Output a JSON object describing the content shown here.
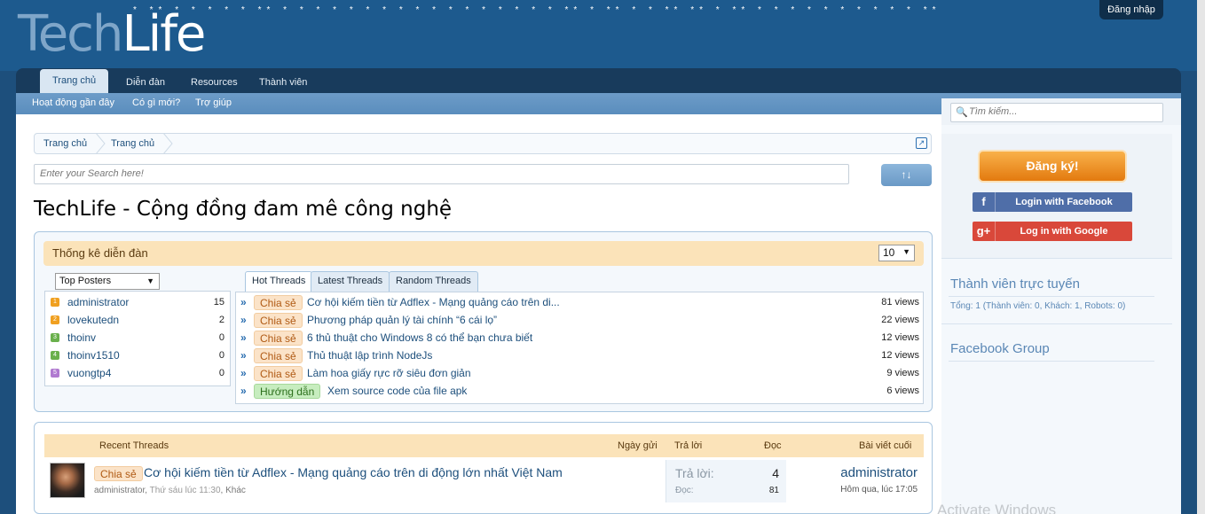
{
  "header": {
    "logo_part1": "Tech",
    "logo_part2": "Life",
    "stars": "* ** * *   *    * *   **  * * *      *   *  *  * *   *  * *  * *   *   *     *  *  **  *   ** * * ** **  * ** * *  * *  * *  *  * * *  **",
    "login_label": "Đăng nhập"
  },
  "nav": {
    "tabs": [
      "Trang chủ",
      "Diễn đàn",
      "Resources",
      "Thành viên"
    ],
    "subnav": [
      "Hoạt động gần đây",
      "Có gì mới?",
      "Trợ giúp"
    ]
  },
  "breadcrumb": [
    "Trang chủ",
    "Trang chủ"
  ],
  "search": {
    "placeholder": "Enter your Search here!"
  },
  "page_title": "TechLife - Cộng đồng đam mê công nghệ",
  "stats": {
    "title": "Thống kê diễn đàn",
    "limit": "10",
    "posters_select": "Top Posters",
    "posters": [
      {
        "name": "administrator",
        "count": "15",
        "badge": "1",
        "color": "#f0a020"
      },
      {
        "name": "lovekutedn",
        "count": "2",
        "badge": "2",
        "color": "#f0a020"
      },
      {
        "name": "thoinv",
        "count": "0",
        "badge": "3",
        "color": "#6ab04c"
      },
      {
        "name": "thoinv1510",
        "count": "0",
        "badge": "4",
        "color": "#6ab04c"
      },
      {
        "name": "vuongtp4",
        "count": "0",
        "badge": "5",
        "color": "#b07ad0"
      }
    ],
    "tabs": [
      "Hot Threads",
      "Latest Threads",
      "Random Threads"
    ],
    "threads": [
      {
        "prefix": "Chia sẻ",
        "type": "share",
        "title": "Cơ hội kiếm tiền từ Adflex - Mạng quảng cáo trên di...",
        "views": "81 views"
      },
      {
        "prefix": "Chia sẻ",
        "type": "share",
        "title": "Phương pháp quản lý tài chính “6 cái lọ”",
        "views": "22 views"
      },
      {
        "prefix": "Chia sẻ",
        "type": "share",
        "title": "6 thủ thuật cho Windows 8 có thể bạn chưa biết",
        "views": "12 views"
      },
      {
        "prefix": "Chia sẻ",
        "type": "share",
        "title": "Thủ thuật lập trình NodeJs",
        "views": "12 views"
      },
      {
        "prefix": "Chia sẻ",
        "type": "share",
        "title": "Làm hoa giấy rực rỡ siêu đơn giản",
        "views": "9 views"
      },
      {
        "prefix": "Hướng dẫn",
        "type": "guide",
        "title": "Xem source code của file apk",
        "views": "6 views"
      }
    ]
  },
  "recent": {
    "headers": [
      "Recent Threads",
      "Ngày gửi",
      "Trả lời",
      "Đọc",
      "Bài viết cuối"
    ],
    "row": {
      "prefix": "Chia sẻ",
      "title": "Cơ hội kiếm tiền từ Adflex - Mạng quảng cáo trên di động lớn nhất Việt Nam",
      "author": "administrator",
      "date": "Thứ sáu lúc 11:30",
      "category": "Khác",
      "replies_label": "Trả lời:",
      "replies": "4",
      "views_label": "Đọc:",
      "views": "81",
      "last_user": "administrator",
      "last_time": "Hôm qua, lúc 17:05"
    }
  },
  "sidebar": {
    "search_placeholder": "Tìm kiếm...",
    "register": "Đăng ký!",
    "facebook": "Login with Facebook",
    "google": "Log in with Google",
    "online_title": "Thành viên trực tuyến",
    "online_stats": "Tổng: 1 (Thành viên: 0, Khách: 1, Robots: 0)",
    "fb_group": "Facebook Group"
  },
  "watermark": "Activate Windows"
}
